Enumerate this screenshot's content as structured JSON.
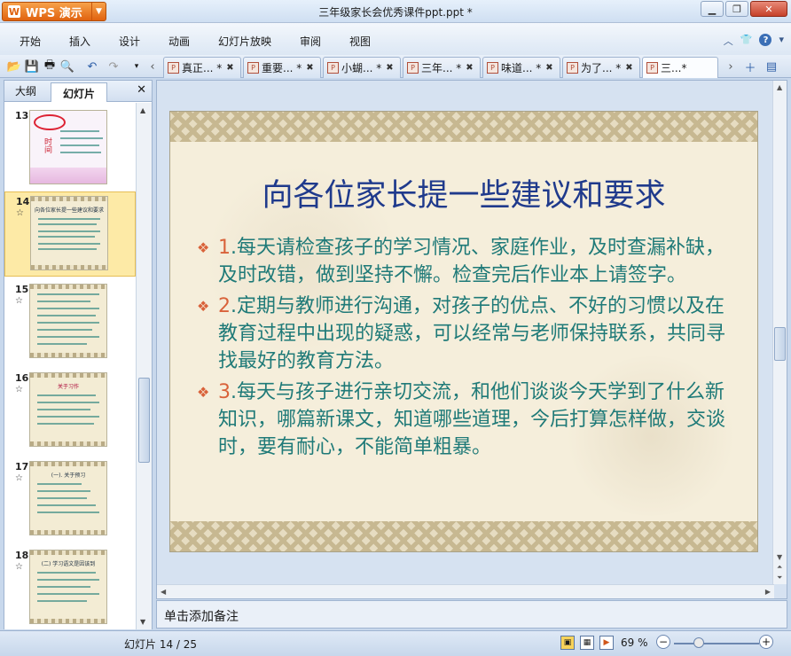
{
  "app": {
    "name": "WPS 演示",
    "logo_letter": "W",
    "window_title": "三年级家长会优秀课件ppt.ppt *"
  },
  "menu": [
    "开始",
    "插入",
    "设计",
    "动画",
    "幻灯片放映",
    "审阅",
    "视图"
  ],
  "tabs": [
    {
      "label": "真正... *"
    },
    {
      "label": "重要... *"
    },
    {
      "label": "小蝴... *"
    },
    {
      "label": "三年... *"
    },
    {
      "label": "味道... *"
    },
    {
      "label": "为了... *"
    },
    {
      "label": "三...*"
    }
  ],
  "left_panel": {
    "tab_outline": "大纲",
    "tab_slides": "幻灯片"
  },
  "thumbnails": [
    {
      "num": "13",
      "title": ""
    },
    {
      "num": "14",
      "title": "向各位家长提一些建议和要求"
    },
    {
      "num": "15",
      "title": ""
    },
    {
      "num": "16",
      "title": "关于习作"
    },
    {
      "num": "17",
      "title": "(一). 关于预习"
    },
    {
      "num": "18",
      "title": "(二) 学习语文是因该到"
    }
  ],
  "slide": {
    "title": "向各位家长提一些建议和要求",
    "bullets": [
      {
        "num": "1",
        "text": ".每天请检查孩子的学习情况、家庭作业，及时查漏补缺，及时改错，做到坚持不懈。检查完后作业本上请签字。"
      },
      {
        "num": "2",
        "text": ".定期与教师进行沟通，对孩子的优点、不好的习惯以及在教育过程中出现的疑惑，可以经常与老师保持联系，共同寻找最好的教育方法。"
      },
      {
        "num": "3",
        "text": ".每天与孩子进行亲切交流，和他们谈谈今天学到了什么新知识，哪篇新课文，知道哪些道理，今后打算怎样做，交谈时，要有耐心，不能简单粗暴。"
      }
    ]
  },
  "notes_placeholder": "单击添加备注",
  "status": {
    "slide_counter": "幻灯片 14 / 25",
    "zoom": "69 %"
  }
}
